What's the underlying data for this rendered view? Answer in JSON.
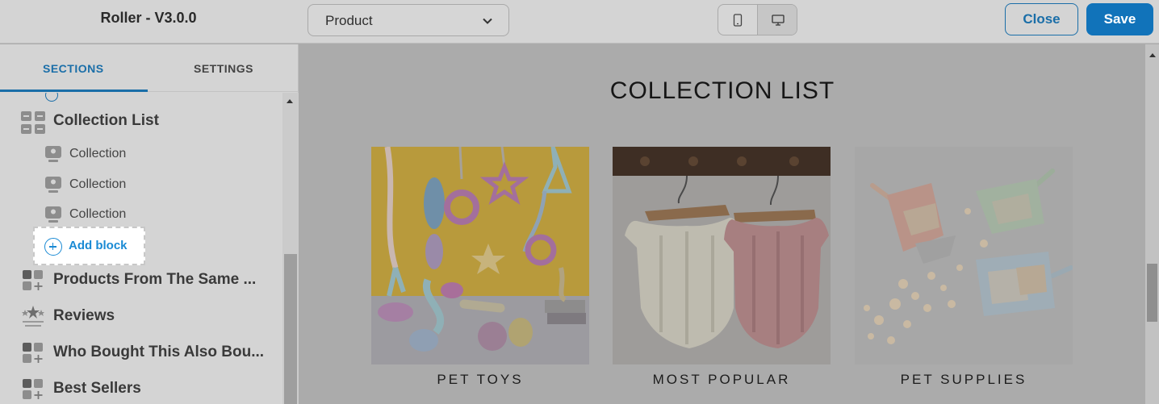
{
  "header": {
    "app_title": "Roller - V3.0.0",
    "page_select_value": "Product",
    "device_modes": [
      "mobile-icon",
      "desktop-icon"
    ],
    "active_device": "desktop",
    "close_label": "Close",
    "save_label": "Save"
  },
  "sidebar": {
    "tabs": [
      {
        "label": "SECTIONS",
        "active": true
      },
      {
        "label": "SETTINGS",
        "active": false
      }
    ],
    "collection_list": {
      "label": "Collection List",
      "icon": "collection-list-icon",
      "blocks": [
        {
          "label": "Collection",
          "icon": "collection-block-icon"
        },
        {
          "label": "Collection",
          "icon": "collection-block-icon"
        },
        {
          "label": "Collection",
          "icon": "collection-block-icon"
        }
      ],
      "add_block_label": "Add block"
    },
    "sections": [
      {
        "label": "Products From The Same ...",
        "icon": "product-grid-icon"
      },
      {
        "label": "Reviews",
        "icon": "reviews-stars-icon"
      },
      {
        "label": "Who Bought This Also Bou...",
        "icon": "product-grid-icon"
      },
      {
        "label": "Best Sellers",
        "icon": "product-grid-icon"
      }
    ]
  },
  "preview": {
    "collection_title": "COLLECTION LIST",
    "collections": [
      {
        "caption": "PET TOYS",
        "image": "pet-toys-photo"
      },
      {
        "caption": "MOST POPULAR",
        "image": "pet-sweaters-photo"
      },
      {
        "caption": "PET SUPPLIES",
        "image": "pet-supplies-photo"
      }
    ]
  },
  "colors": {
    "accent": "#1a6ea8",
    "save_button": "#1173ba",
    "add_block_text": "#1a8ad4",
    "overlay_background": "#ababab"
  }
}
